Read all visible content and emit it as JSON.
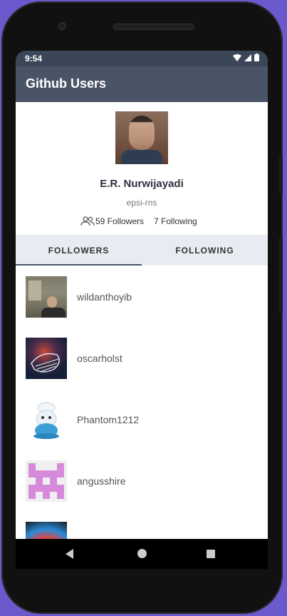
{
  "status": {
    "time": "9:54"
  },
  "appbar": {
    "title": "Github Users"
  },
  "profile": {
    "name": "E.R. Nurwijayadi",
    "login": "epsi-rns",
    "followers_text": "59 Followers",
    "following_text": "7 Following"
  },
  "tabs": [
    {
      "label": "FOLLOWERS",
      "selected": true
    },
    {
      "label": "FOLLOWING",
      "selected": false
    }
  ],
  "followers": [
    {
      "username": "wildanthoyib"
    },
    {
      "username": "oscarholst"
    },
    {
      "username": "Phantom1212"
    },
    {
      "username": "angusshire"
    }
  ],
  "colors": {
    "appbar": "#4a5467",
    "statusbar": "#3c4659",
    "tabs_bg": "#e8ebf1",
    "background": "#6a5acd"
  }
}
